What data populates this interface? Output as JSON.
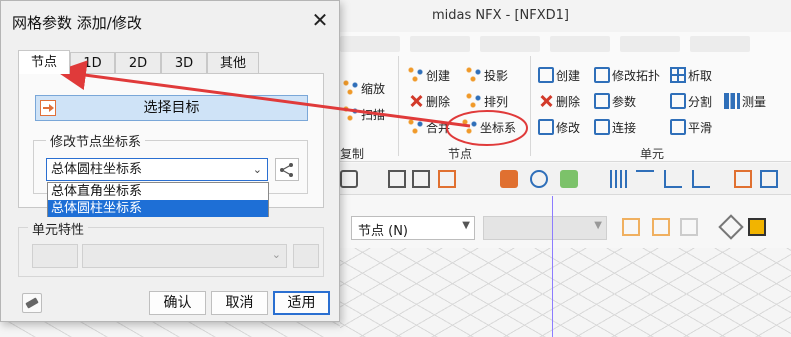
{
  "app": {
    "title": "midas NFX - [NFXD1]",
    "ribbon": {
      "left_partial": [
        {
          "label": "缩放",
          "icon": "zoom-icon"
        },
        {
          "label": "扫描",
          "icon": "sweep-icon"
        }
      ],
      "left_group_label": "复制",
      "node_group": {
        "label": "节点",
        "items": [
          {
            "label": "创建",
            "icon": "node-create-icon"
          },
          {
            "label": "投影",
            "icon": "project-icon"
          },
          {
            "label": "删除",
            "icon": "node-delete-icon"
          },
          {
            "label": "排列",
            "icon": "arrange-icon"
          },
          {
            "label": "合并",
            "icon": "merge-icon"
          },
          {
            "label": "坐标系",
            "icon": "coordinate-system-icon"
          }
        ]
      },
      "element_group": {
        "label": "单元",
        "items": [
          {
            "label": "创建",
            "icon": "element-create-icon"
          },
          {
            "label": "修改拓扑",
            "icon": "modify-topology-icon"
          },
          {
            "label": "析取",
            "icon": "extract-icon"
          },
          {
            "label": "删除",
            "icon": "element-delete-icon"
          },
          {
            "label": "参数",
            "icon": "parameters-icon"
          },
          {
            "label": "分割",
            "icon": "split-icon"
          },
          {
            "label": "测量",
            "icon": "measure-icon"
          },
          {
            "label": "修改",
            "icon": "modify-icon"
          },
          {
            "label": "连接",
            "icon": "connect-icon"
          },
          {
            "label": "平滑",
            "icon": "smooth-icon"
          }
        ]
      }
    },
    "filter_select": {
      "value": "节点 (N)"
    }
  },
  "dialog": {
    "title": "网格参数 添加/修改",
    "tabs": [
      "节点",
      "1D",
      "2D",
      "3D",
      "其他"
    ],
    "active_tab": "节点",
    "select_target_label": "选择目标",
    "coord_group_title": "修改节点坐标系",
    "coord_combo_value": "总体圆柱坐标系",
    "coord_options": [
      "总体直角坐标系",
      "总体圆柱坐标系"
    ],
    "selected_option": "总体圆柱坐标系",
    "element_props_title": "单元特性",
    "buttons": {
      "confirm": "确认",
      "cancel": "取消",
      "apply": "适用"
    }
  },
  "colors": {
    "accent_blue": "#2a6fd1",
    "selection_blue": "#1e6fd6",
    "annotation_red": "#e03a3a",
    "button_highlight": "#cfe3f7"
  }
}
